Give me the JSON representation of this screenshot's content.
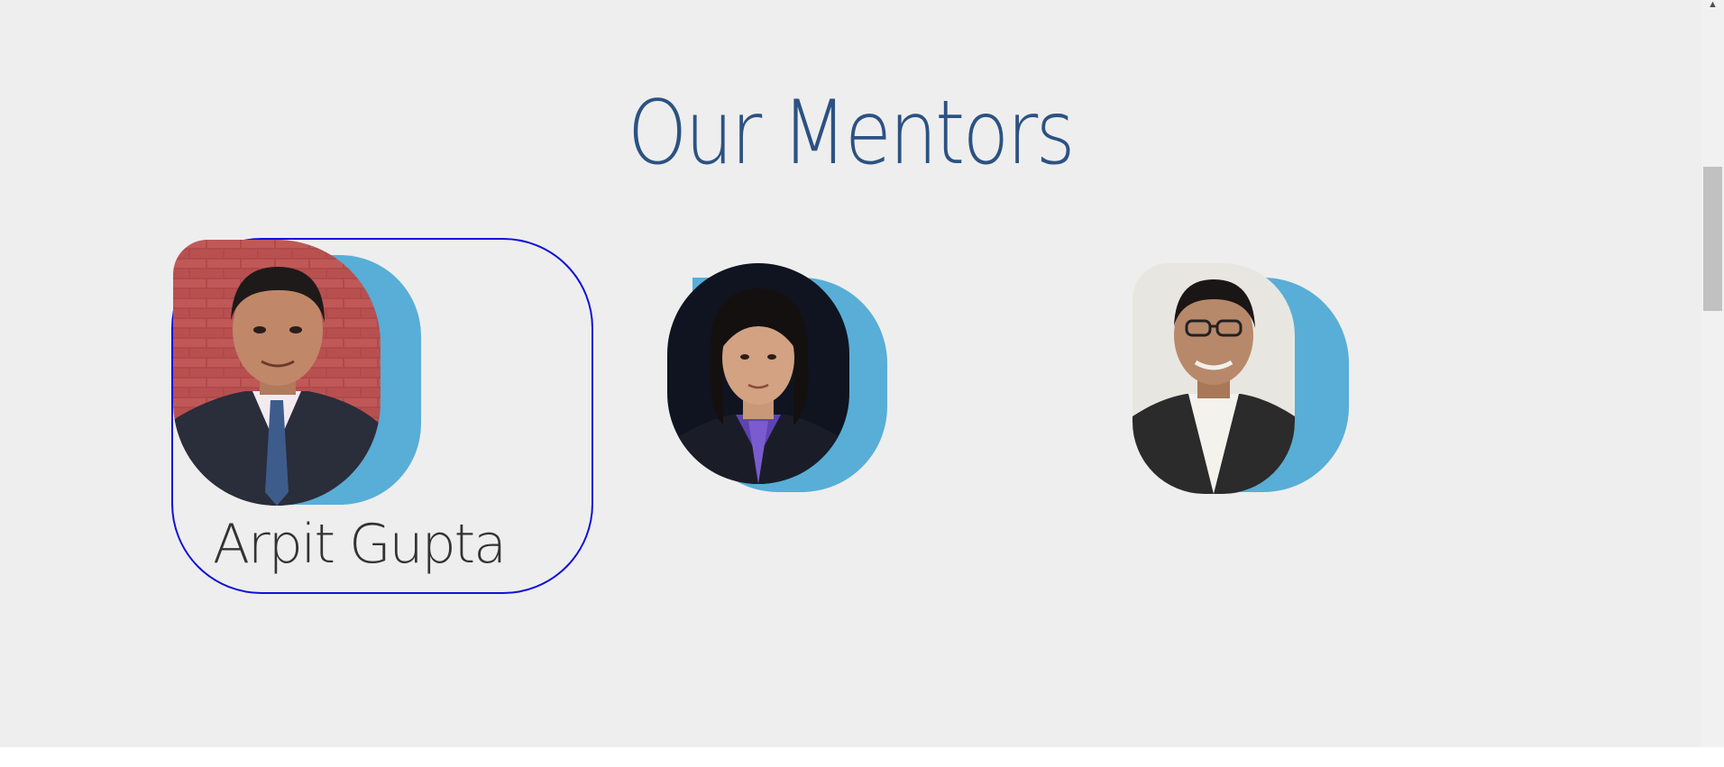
{
  "section": {
    "title": "Our Mentors"
  },
  "mentors": [
    {
      "name": "Arpit Gupta",
      "photo": "mentor-1-photo",
      "active": true
    },
    {
      "name": "",
      "photo": "mentor-2-photo",
      "active": false
    },
    {
      "name": "",
      "photo": "mentor-3-photo",
      "active": false
    }
  ],
  "colors": {
    "background": "#eeeeee",
    "title": "#2c5282",
    "accent": "#58aed6",
    "focus_ring": "#1010d8",
    "name_text": "#333333"
  },
  "scrollbar": {
    "up_arrow_icon": "triangle-up-icon"
  }
}
